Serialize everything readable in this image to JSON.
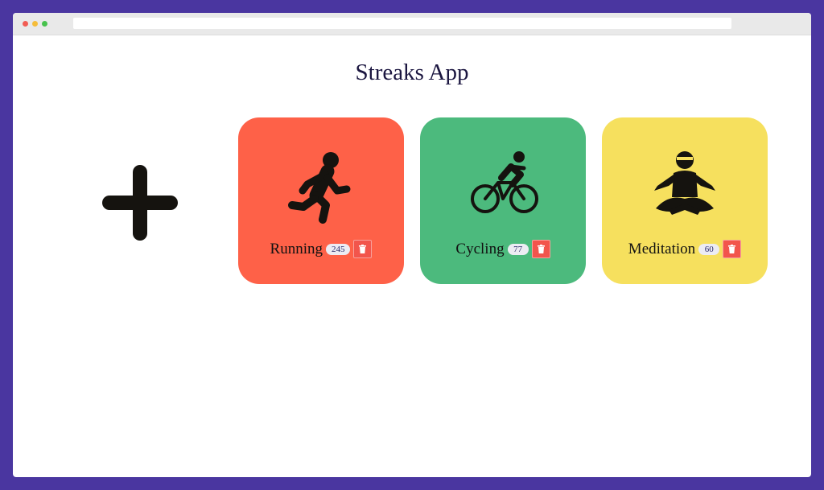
{
  "app": {
    "title": "Streaks App"
  },
  "add_button": {
    "icon": "plus-icon"
  },
  "streaks": [
    {
      "name": "Running",
      "count": "245",
      "color": "#fe6148",
      "icon": "running-icon"
    },
    {
      "name": "Cycling",
      "count": "77",
      "color": "#4cba7d",
      "icon": "cycling-icon"
    },
    {
      "name": "Meditation",
      "count": "60",
      "color": "#f6e05e",
      "icon": "meditation-icon"
    }
  ],
  "colors": {
    "background": "#4a36a0",
    "delete": "#f2554c"
  }
}
